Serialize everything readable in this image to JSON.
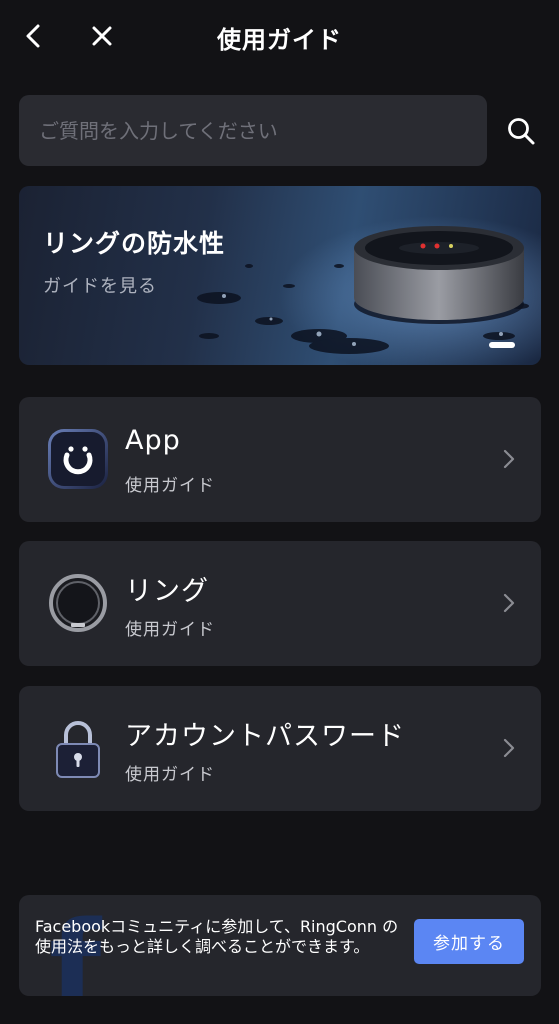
{
  "header": {
    "title": "使用ガイド",
    "back_icon": "chevron-left-icon",
    "close_icon": "close-icon"
  },
  "search": {
    "placeholder": "ご質問を入力してください",
    "icon": "search-icon"
  },
  "banner": {
    "title": "リングの防水性",
    "subtitle": "ガイドを見る"
  },
  "guides": [
    {
      "title": "App",
      "subtitle": "使用ガイド",
      "icon": "app-logo-icon"
    },
    {
      "title": "リング",
      "subtitle": "使用ガイド",
      "icon": "ring-icon"
    },
    {
      "title": "アカウントパスワード",
      "subtitle": "使用ガイド",
      "icon": "lock-icon"
    }
  ],
  "promo": {
    "text": "Facebookコミュニティに参加して、RingConn の使用法をもっと詳しく調べることができます。",
    "button_label": "参加する"
  },
  "colors": {
    "background": "#121215",
    "card": "#25262c",
    "accent": "#5b86f3"
  }
}
